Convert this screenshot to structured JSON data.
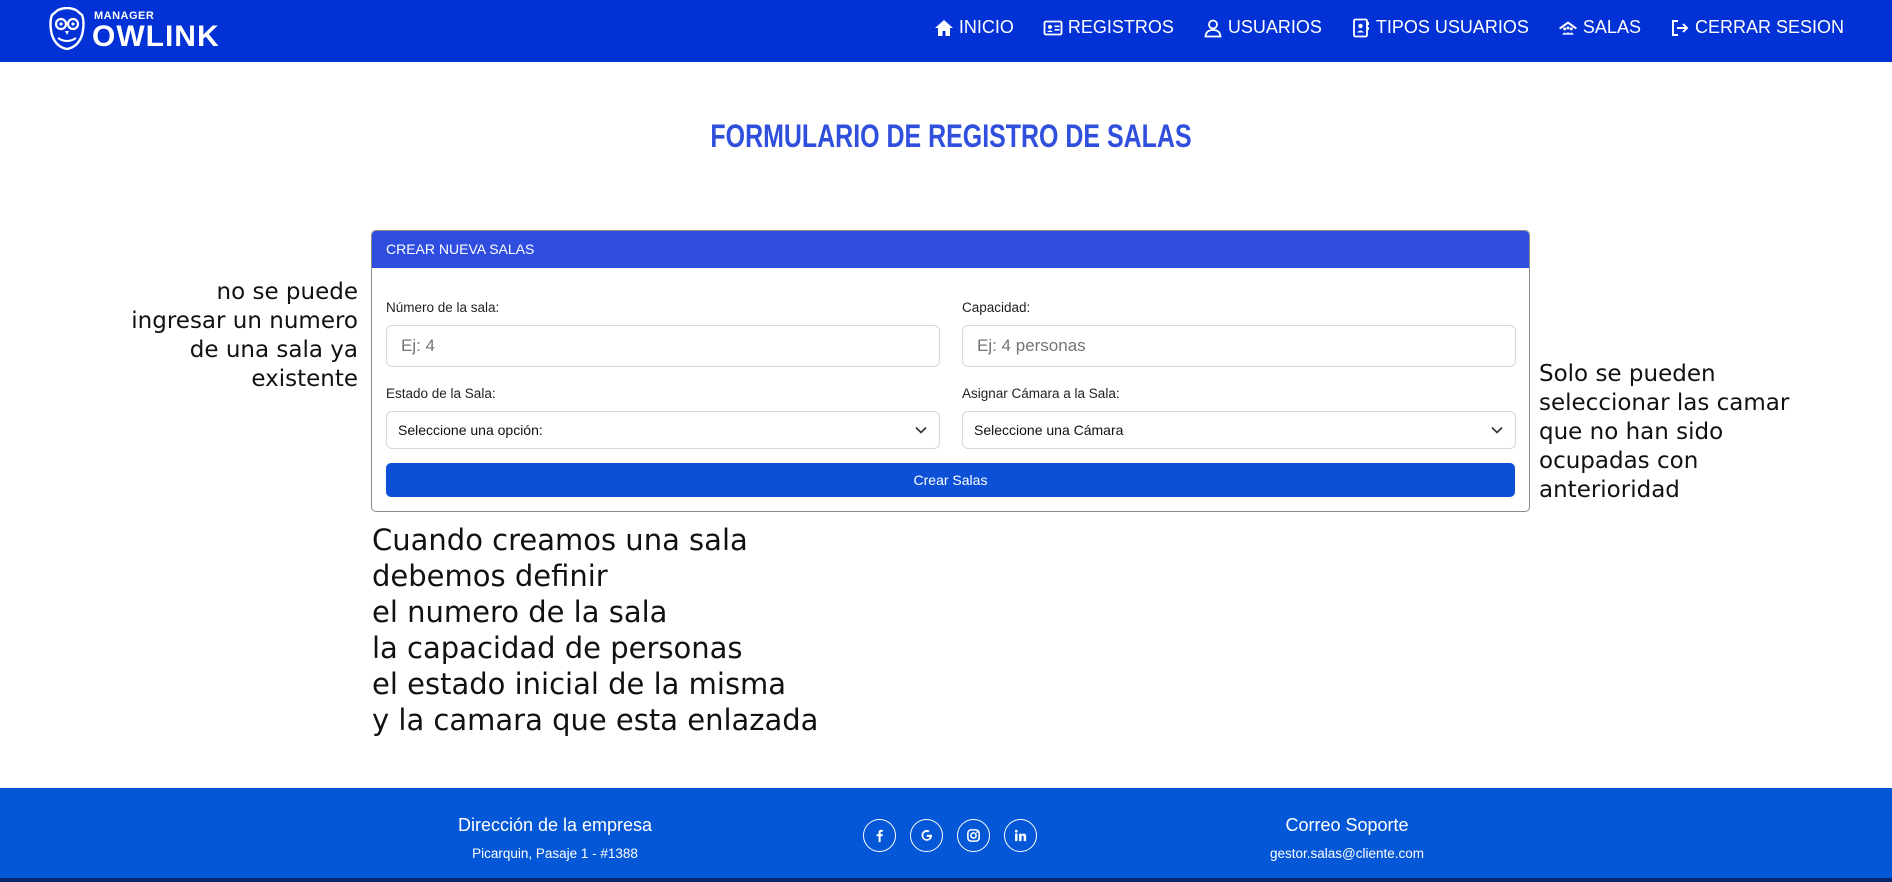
{
  "brand": {
    "small": "MANAGER",
    "big": "OWLINK"
  },
  "nav": [
    {
      "label": "INICIO",
      "icon": "home-icon"
    },
    {
      "label": "REGISTROS",
      "icon": "id-card-icon"
    },
    {
      "label": "USUARIOS",
      "icon": "user-icon"
    },
    {
      "label": "TIPOS USUARIOS",
      "icon": "contact-card-icon"
    },
    {
      "label": "SALAS",
      "icon": "room-icon"
    },
    {
      "label": "CERRAR SESION",
      "icon": "logout-icon"
    }
  ],
  "page": {
    "title": "FORMULARIO DE REGISTRO DE SALAS"
  },
  "form": {
    "header": "CREAR NUEVA SALAS",
    "numero": {
      "label": "Número de la sala:",
      "placeholder": "Ej: 4"
    },
    "capacidad": {
      "label": "Capacidad:",
      "placeholder": "Ej: 4 personas"
    },
    "estado": {
      "label": "Estado de la Sala:",
      "selected": "Seleccione una opción:"
    },
    "camara": {
      "label": "Asignar Cámara a la Sala:",
      "selected": "Seleccione una Cámara"
    },
    "submit": "Crear Salas"
  },
  "notes": {
    "left": "no se puede\ningresar un numero\nde una sala ya\nexistente",
    "right": "Solo se pueden\nseleccionar las camar\nque no han sido\nocupadas con\nanterioridad",
    "main": "Cuando creamos una sala\ndebemos definir\nel numero de la sala\nla capacidad de personas\nel estado inicial de la misma\ny la camara que esta enlazada"
  },
  "footer": {
    "address_title": "Dirección de la empresa",
    "address": "Picarquin, Pasaje 1 - #1388",
    "support_title": "Correo Soporte",
    "support_email": "gestor.salas@cliente.com",
    "socials": [
      "facebook-icon",
      "google-icon",
      "instagram-icon",
      "linkedin-icon"
    ]
  },
  "colors": {
    "navbar": "#0232d6",
    "title": "#2f4fdc",
    "card_header": "#2f4ee0",
    "button": "#0b50d6",
    "footer": "#0457d6"
  }
}
